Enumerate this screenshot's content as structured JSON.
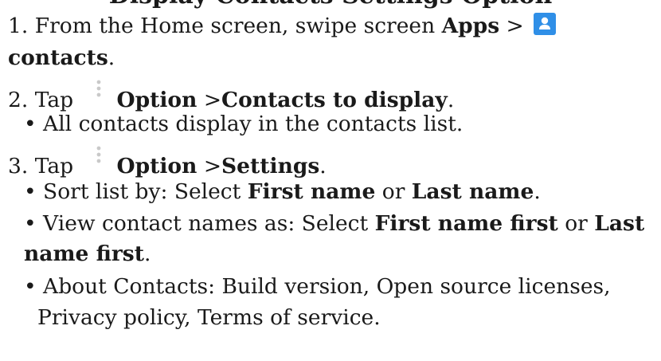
{
  "title_fragment": "Display Contacts Settings Option",
  "step1": {
    "prefix": "1. From the Home screen, swipe screen ",
    "apps": "Apps",
    "sep": " > ",
    "contacts": "contacts",
    "period": "."
  },
  "step2": {
    "prefix": "2. Tap ",
    "option": "Option",
    "sep": " >",
    "target": "Contacts to display",
    "period": ".",
    "bullet": "• All contacts display in the contacts list."
  },
  "step3": {
    "prefix": "3. Tap ",
    "option": "Option",
    "sep": " >",
    "target": "Settings",
    "period": ".",
    "sort": {
      "pre": "• Sort list by: Select ",
      "a": "First name",
      "mid": " or ",
      "b": "Last name",
      "end": "."
    },
    "view": {
      "pre": "• View contact names as: Select ",
      "a": "First name first",
      "mid": " or ",
      "b1": "Last",
      "b2": "name first",
      "end": "."
    },
    "about": {
      "line1": "• About Contacts: Build version, Open source licenses,",
      "line2": "Privacy policy, Terms of service."
    }
  },
  "icons": {
    "contacts": "contacts-app-icon",
    "menu": "more-options-icon"
  },
  "colors": {
    "contacts_icon_bg": "#2f8fe7",
    "menu_dots": "#c9c9c9"
  }
}
